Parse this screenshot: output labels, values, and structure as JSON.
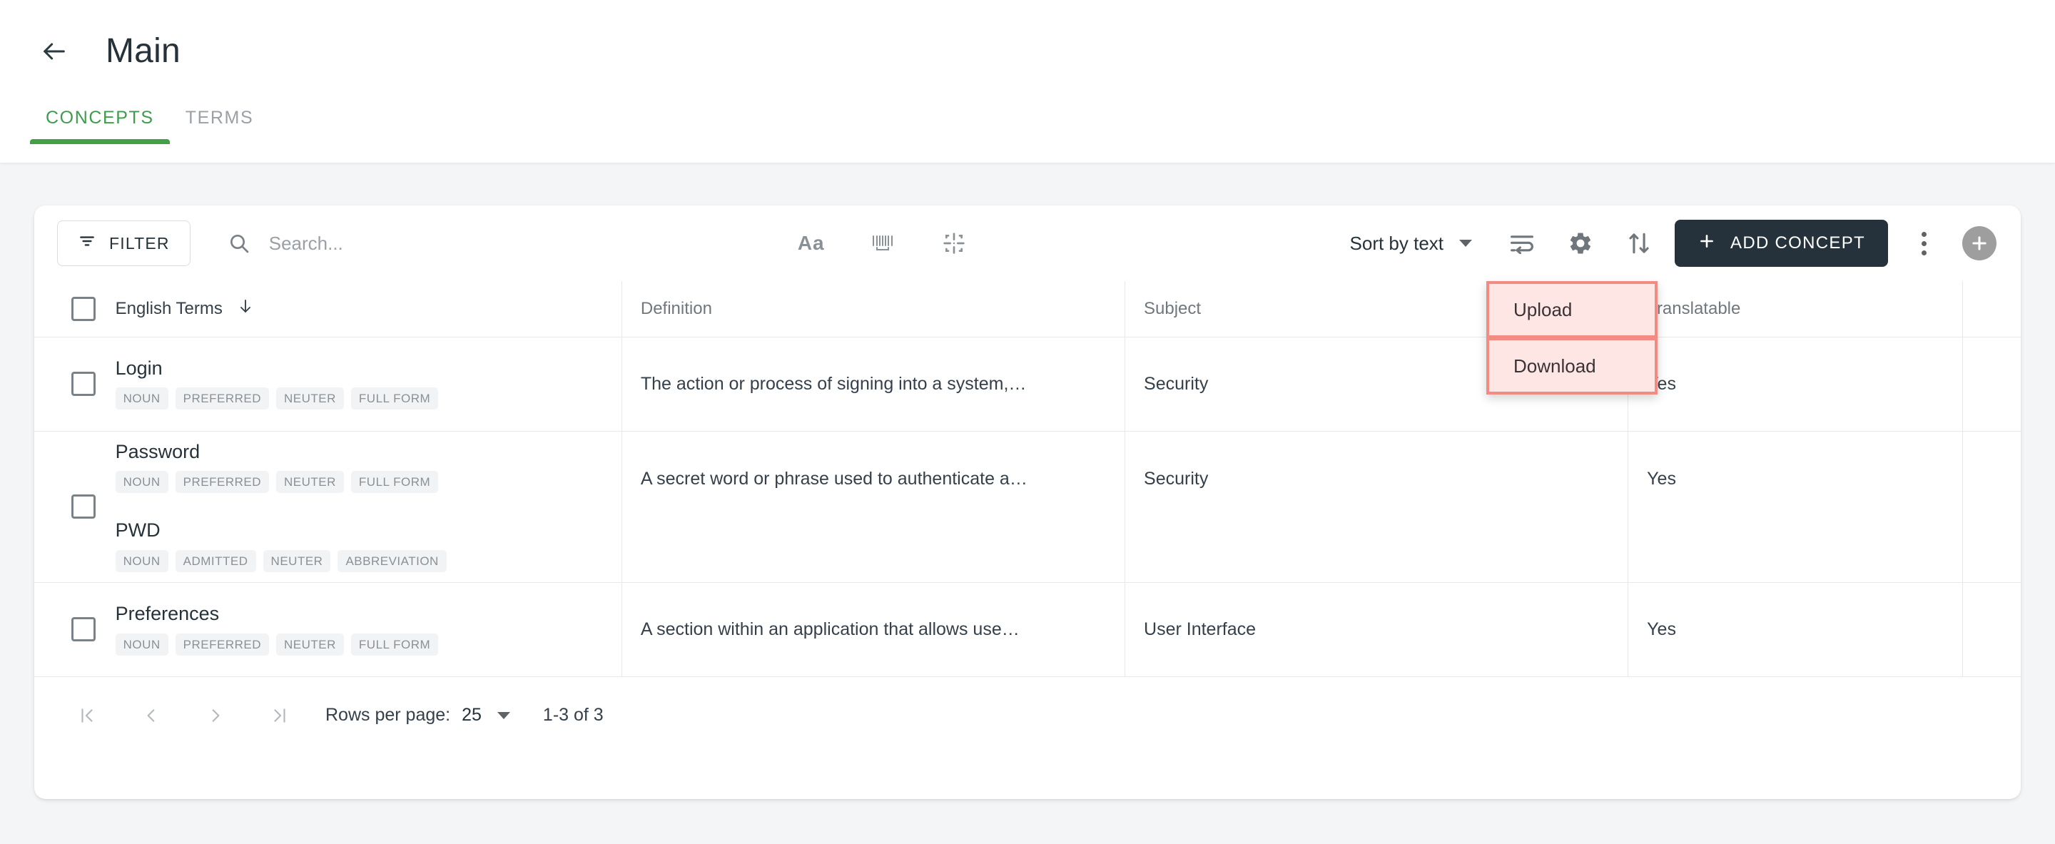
{
  "header": {
    "back_icon": "arrow-left-icon",
    "title": "Main",
    "tabs": [
      {
        "label": "CONCEPTS",
        "active": true
      },
      {
        "label": "TERMS",
        "active": false
      }
    ]
  },
  "toolbar": {
    "filter_label": "FILTER",
    "filter_icon": "filter-icon",
    "search": {
      "placeholder": "Search...",
      "value": "",
      "icon": "search-icon"
    },
    "mid_icons": [
      {
        "name": "match-case-icon",
        "glyph": "Aa"
      },
      {
        "name": "barcode-icon",
        "glyph": ""
      },
      {
        "name": "crop-target-icon",
        "glyph": ""
      }
    ],
    "sort_label": "Sort by text",
    "right_icons": [
      {
        "name": "wrap-text-icon"
      },
      {
        "name": "gear-icon"
      },
      {
        "name": "import-export-icon"
      }
    ],
    "add_concept_label": "ADD CONCEPT",
    "add_concept_icon": "plus-icon",
    "kebab_icon": "more-vertical-icon",
    "fab_icon": "plus-circle-icon"
  },
  "dropdown": {
    "items": [
      {
        "label": "Upload",
        "name": "menu-item-upload"
      },
      {
        "label": "Download",
        "name": "menu-item-download"
      }
    ],
    "highlight_border": "#f28b82",
    "highlight_fill": "#fde6e3"
  },
  "table": {
    "columns": [
      {
        "key": "terms",
        "label": "English Terms",
        "sort_icon": "arrow-down-icon"
      },
      {
        "key": "definition",
        "label": "Definition"
      },
      {
        "key": "subject",
        "label": "Subject"
      },
      {
        "key": "translatable",
        "label": "Translatable"
      }
    ],
    "rows": [
      {
        "terms": [
          {
            "name": "Login",
            "chips": [
              "NOUN",
              "PREFERRED",
              "NEUTER",
              "FULL FORM"
            ]
          }
        ],
        "definition": "The action or process of signing into a system,…",
        "subject": "Security",
        "translatable": "Yes"
      },
      {
        "terms": [
          {
            "name": "Password",
            "chips": [
              "NOUN",
              "PREFERRED",
              "NEUTER",
              "FULL FORM"
            ]
          },
          {
            "name": "PWD",
            "chips": [
              "NOUN",
              "ADMITTED",
              "NEUTER",
              "ABBREVIATION"
            ]
          }
        ],
        "definition": "A secret word or phrase used to authenticate a…",
        "subject": "Security",
        "translatable": "Yes"
      },
      {
        "terms": [
          {
            "name": "Preferences",
            "chips": [
              "NOUN",
              "PREFERRED",
              "NEUTER",
              "FULL FORM"
            ]
          }
        ],
        "definition": "A section within an application that allows use…",
        "subject": "User Interface",
        "translatable": "Yes"
      }
    ]
  },
  "pagination": {
    "first_icon": "first-page-icon",
    "prev_icon": "prev-page-icon",
    "next_icon": "next-page-icon",
    "last_icon": "last-page-icon",
    "rows_per_page_label": "Rows per page:",
    "rows_per_page_value": "25",
    "range_label": "1-3 of 3"
  },
  "colors": {
    "accent_green": "#43a047",
    "dark_button": "#25323b",
    "page_bg": "#f3f5f7"
  }
}
